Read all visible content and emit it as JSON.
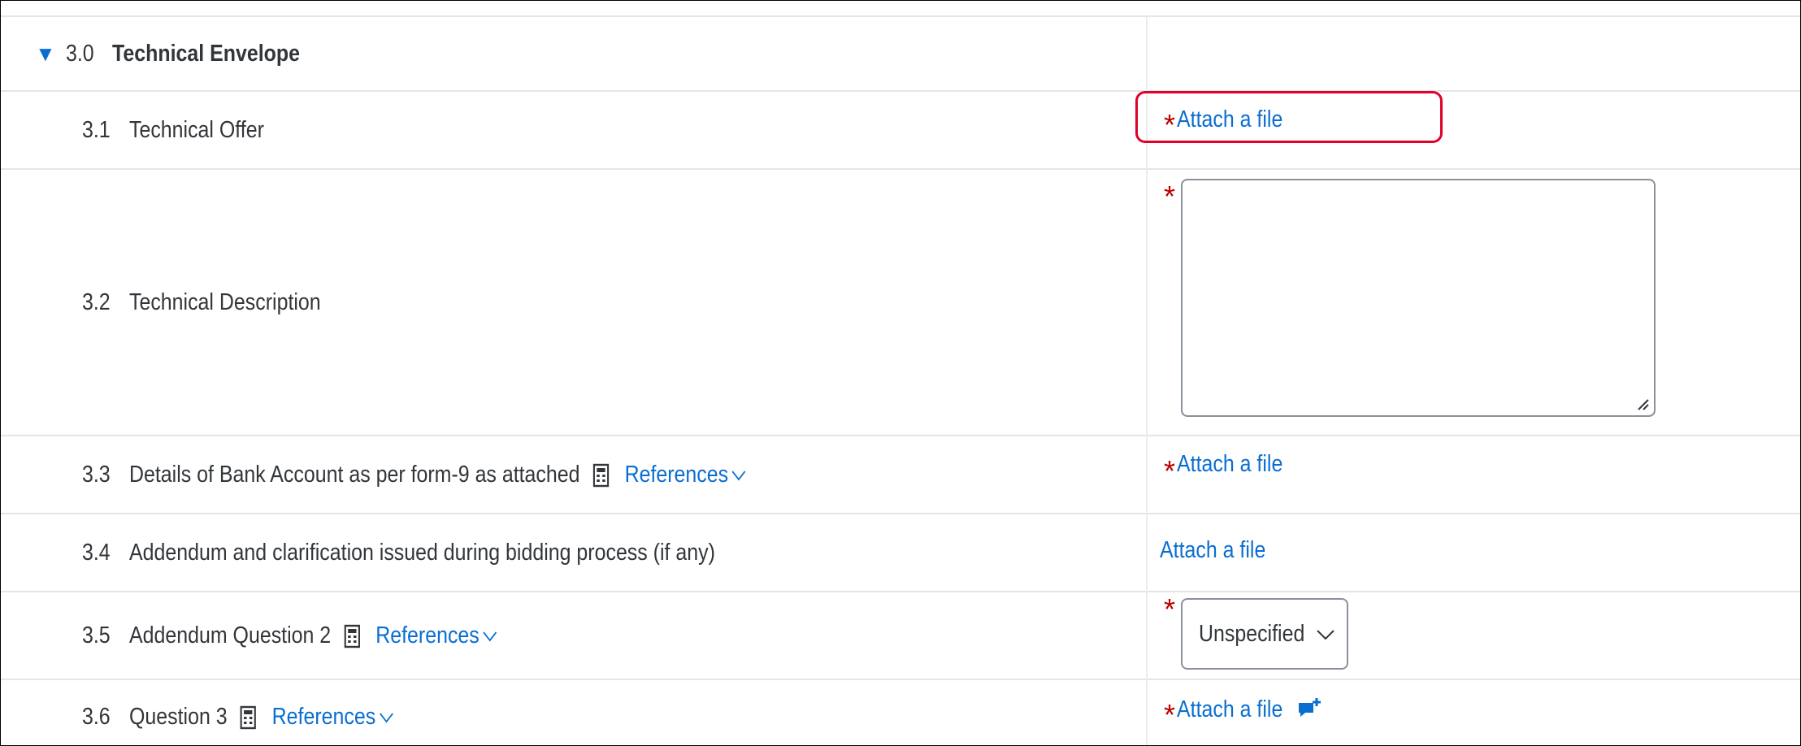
{
  "section": {
    "toggle": "▼",
    "number": "3.0",
    "title": "Technical Envelope"
  },
  "rows": [
    {
      "number": "3.1",
      "label": "Technical Offer",
      "action": "Attach a file",
      "required": "*"
    },
    {
      "number": "3.2",
      "label": "Technical Description",
      "required": "*"
    },
    {
      "number": "3.3",
      "label": "Details of Bank Account as per form-9 as attached",
      "references": "References",
      "action": "Attach a file",
      "required": "*"
    },
    {
      "number": "3.4",
      "label": "Addendum and clarification issued during bidding process (if any)",
      "action": "Attach a file"
    },
    {
      "number": "3.5",
      "label": "Addendum Question 2",
      "references": "References",
      "select_value": "Unspecified",
      "required": "*"
    },
    {
      "number": "3.6",
      "label": "Question 3",
      "references": "References",
      "action": "Attach a file",
      "required": "*"
    }
  ],
  "colors": {
    "link": "#0a6ed1",
    "required": "#bb0000",
    "highlight": "#e0002a"
  }
}
